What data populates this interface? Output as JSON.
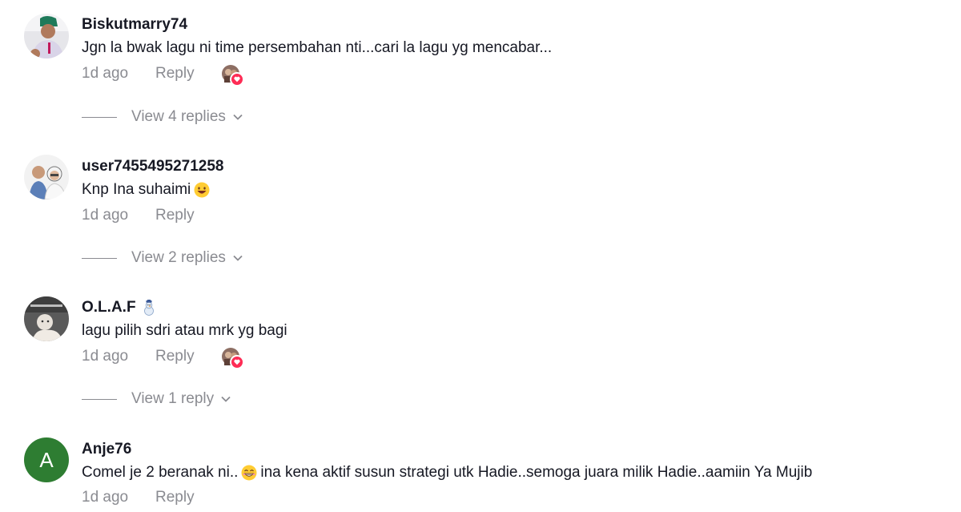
{
  "comments": [
    {
      "username": "Biskutmarry74",
      "text": "Jgn la bwak lagu ni time persembahan nti...cari la lagu yg mencabar...",
      "time": "1d ago",
      "reply_label": "Reply",
      "view_replies": "View 4 replies",
      "creator_liked": true
    },
    {
      "username": "user7455495271258",
      "text": "Knp Ina suhaimi",
      "text_emoji": "grinning-face-icon",
      "time": "1d ago",
      "reply_label": "Reply",
      "view_replies": "View 2 replies",
      "creator_liked": false
    },
    {
      "username": "O.L.A.F",
      "username_emoji": "snowman-icon",
      "text": "lagu pilih sdri atau mrk yg bagi",
      "time": "1d ago",
      "reply_label": "Reply",
      "view_replies": "View 1 reply",
      "creator_liked": true
    },
    {
      "username": "Anje76",
      "avatar_letter": "A",
      "text_part1": "Comel je 2 beranak ni..",
      "text_emoji": "beaming-face-icon",
      "text_part2": "ina kena aktif susun strategi utk Hadie..semoga juara milik Hadie..aamiin Ya Mujib",
      "time": "1d ago",
      "reply_label": "Reply"
    }
  ],
  "colors": {
    "primary_text": "#161823",
    "secondary_text": "#8a8b91",
    "like_badge": "#fe2c55",
    "letter_avatar": "#2e7d32"
  }
}
